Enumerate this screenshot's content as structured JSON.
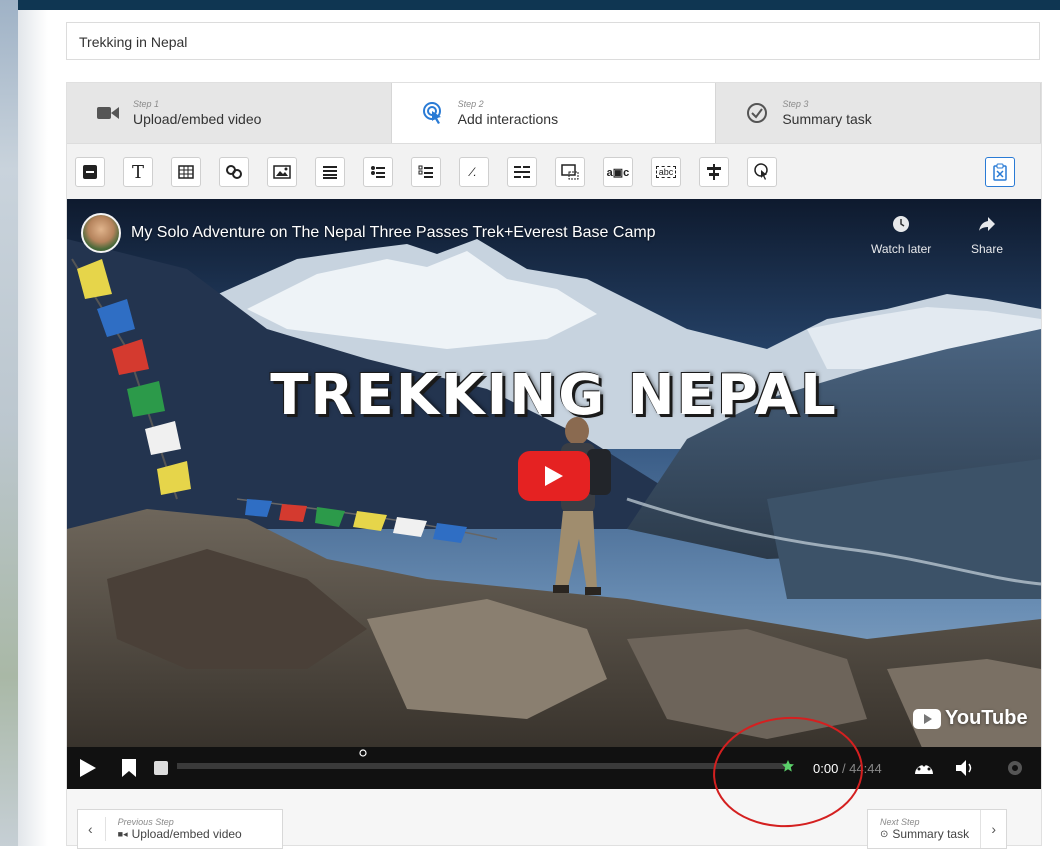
{
  "page": {
    "title_input_value": "Trekking in Nepal"
  },
  "steps": [
    {
      "step": "Step 1",
      "label": "Upload/embed video",
      "icon": "video-camera-icon"
    },
    {
      "step": "Step 2",
      "label": "Add interactions",
      "icon": "touch-pointer-icon",
      "active": true
    },
    {
      "step": "Step 3",
      "label": "Summary task",
      "icon": "check-circle-icon"
    }
  ],
  "toolbar": {
    "tools": [
      "label-tool-icon",
      "text-tool-icon",
      "table-tool-icon",
      "link-tool-icon",
      "image-tool-icon",
      "statements-tool-icon",
      "single-choice-tool-icon",
      "multiple-choice-tool-icon",
      "fill-in-blanks-tool-icon",
      "drag-text-tool-icon",
      "mark-words-tool-icon",
      "drag-drop-tool-icon",
      "crossroads-tool-icon",
      "navigation-hotspot-tool-icon",
      "branching-tool-icon"
    ],
    "right_tool": "clipboard-tool-icon"
  },
  "video": {
    "title": "My Solo Adventure on The Nepal Three Passes Trek+Everest Base Camp",
    "overlay_title": "TREKKING NEPAL",
    "watch_later": "Watch later",
    "share": "Share",
    "brand": "YouTube",
    "current_time": "0:00",
    "total_time": "44:44",
    "progress_fraction": 0.0
  },
  "nav": {
    "previous_small": "Previous Step",
    "previous_label": "Upload/embed video",
    "next_small": "Next Step",
    "next_label": "Summary task"
  },
  "colors": {
    "active_tab": "#ffffff",
    "inactive_tab": "#e6e6e6",
    "play_button": "#e52222",
    "annotation_circle": "#d42020",
    "accent": "#2a7bd5"
  }
}
